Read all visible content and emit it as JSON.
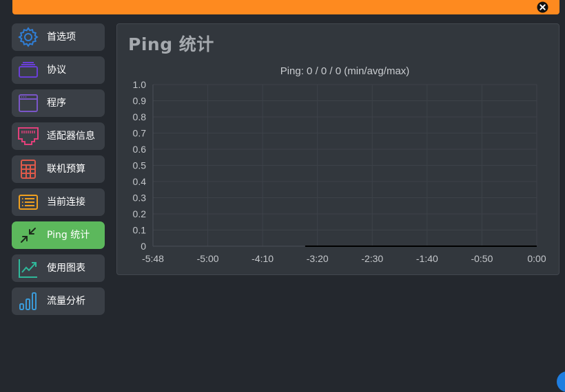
{
  "sidebar": {
    "items": [
      {
        "label": "首选项",
        "icon": "gear-icon",
        "color": "#2f7fd8"
      },
      {
        "label": "协议",
        "icon": "protocol-stack-icon",
        "color": "#6a3fd8"
      },
      {
        "label": "程序",
        "icon": "program-window-icon",
        "color": "#7a56c8"
      },
      {
        "label": "适配器信息",
        "icon": "ethernet-port-icon",
        "color": "#e0407a"
      },
      {
        "label": "联机预算",
        "icon": "calculator-icon",
        "color": "#e05a4a"
      },
      {
        "label": "当前连接",
        "icon": "list-icon",
        "color": "#f0a020"
      },
      {
        "label": "Ping 统计",
        "icon": "compress-arrows-icon",
        "color": "#1c2a1c"
      },
      {
        "label": "使用图表",
        "icon": "trend-chart-icon",
        "color": "#2fb89a"
      },
      {
        "label": "流量分析",
        "icon": "bar-chart-icon",
        "color": "#3a9ad8"
      }
    ],
    "active_index": 6
  },
  "panel": {
    "title": "Ping 统计"
  },
  "chart_data": {
    "type": "line",
    "title": "Ping: 0 / 0 / 0 (min/avg/max)",
    "x_tick_labels": [
      "-5:48",
      "-5:00",
      "-4:10",
      "-3:20",
      "-2:30",
      "-1:40",
      "-0:50",
      "0:00"
    ],
    "y_tick_labels": [
      "1.0",
      "0.9",
      "0.8",
      "0.7",
      "0.6",
      "0.5",
      "0.4",
      "0.3",
      "0.2",
      "0.1",
      "0"
    ],
    "ylim": [
      0,
      1.0
    ],
    "series": [
      {
        "x_seconds": [
          -210,
          0
        ],
        "values": [
          0,
          0
        ]
      }
    ],
    "grid": true,
    "line_color": "#000000"
  }
}
